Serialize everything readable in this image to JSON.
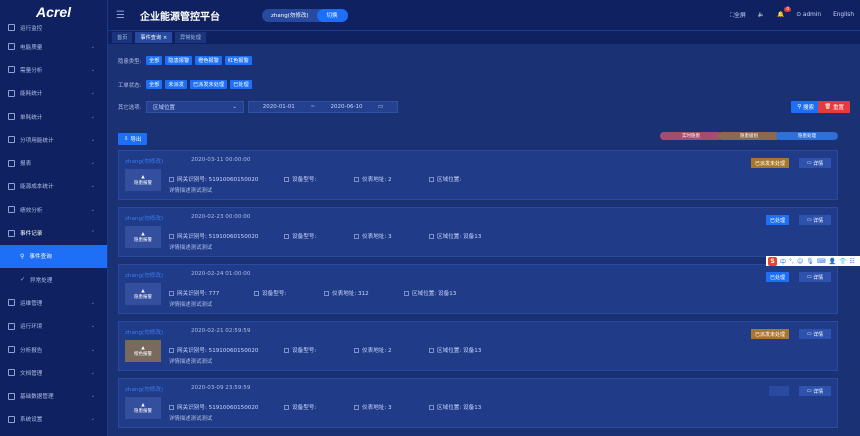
{
  "app": {
    "logo": "Acrel",
    "title": "企业能源管控平台",
    "user_chip": "zhang(勿修改)",
    "switch_label": "切换",
    "fullscreen": "全屏",
    "user": "admin",
    "lang": "English",
    "bell_count": "0"
  },
  "sidebar": {
    "top_partial": "运行监控",
    "items": [
      {
        "label": "电能质量"
      },
      {
        "label": "需量分析"
      },
      {
        "label": "能耗统计"
      },
      {
        "label": "单耗统计"
      },
      {
        "label": "分项用能统计"
      },
      {
        "label": "报表"
      },
      {
        "label": "能源成本统计"
      },
      {
        "label": "绩效分析"
      },
      {
        "label": "事件记录"
      }
    ],
    "sub_active": "事件查询",
    "sub_other": "异常处理",
    "items_after": [
      {
        "label": "运维管理"
      },
      {
        "label": "运行环境"
      },
      {
        "label": "分析报告"
      },
      {
        "label": "文档管理"
      },
      {
        "label": "基础数据管理"
      },
      {
        "label": "系统设置"
      },
      {
        "label": "日志管理"
      }
    ]
  },
  "tabs": {
    "home": "首页",
    "event": "事件查询",
    "abnormal": "异常处理"
  },
  "filters": {
    "type_label": "隐患类型:",
    "type_chips": [
      "全部",
      "隐患报警",
      "橙色报警",
      "红色报警"
    ],
    "status_label": "工单状态:",
    "status_chips": [
      "全部",
      "未派发",
      "已派发未处理",
      "已处理"
    ],
    "other_label": "其它选项:",
    "area_placeholder": "区域位置",
    "date_start": "2020-01-01",
    "date_sep": "~",
    "date_end": "2020-06-10",
    "search": "搜索",
    "reset": "重置"
  },
  "export_label": "导出",
  "legend": [
    "实时隐患",
    "隐患级别",
    "隐患处理"
  ],
  "legend_colors": [
    "#a34e6e",
    "#8c6a52",
    "#2e6fd8"
  ],
  "events": [
    {
      "who": "zhang(勿修改)",
      "time": "2020-03-11 00:00:00",
      "type": "隐患报警",
      "type_warn": false,
      "gateway": "网关识别号: 51910060150020",
      "device": "设备型号:",
      "address": "仪表地址: 2",
      "area": "区域位置:",
      "desc": "详情描述测试测试",
      "status": "已派发未处理",
      "status_kind": "pending",
      "detail": "详情"
    },
    {
      "who": "zhang(勿修改)",
      "time": "2020-02-23 00:00:00",
      "type": "隐患报警",
      "type_warn": false,
      "gateway": "网关识别号: 51910060150020",
      "device": "设备型号:",
      "address": "仪表地址: 3",
      "area": "区域位置: 设备13",
      "desc": "详情描述测试测试",
      "status": "已处理",
      "status_kind": "done",
      "detail": "详情"
    },
    {
      "who": "zhang(勿修改)",
      "time": "2020-02-24 01:00:00",
      "type": "隐患报警",
      "type_warn": false,
      "gateway": "网关识别号: 777",
      "device": "设备型号:",
      "address": "仪表地址: 312",
      "area": "区域位置: 设备13",
      "desc": "详情描述测试测试",
      "status": "已处理",
      "status_kind": "done",
      "detail": "详情"
    },
    {
      "who": "zhang(勿修改)",
      "time": "2020-02-21 02:59:59",
      "type": "橙色报警",
      "type_warn": true,
      "gateway": "网关识别号: 51910060150020",
      "device": "设备型号:",
      "address": "仪表地址: 2",
      "area": "区域位置: 设备13",
      "desc": "详情描述测试测试",
      "status": "已派发未处理",
      "status_kind": "pending",
      "detail": "详情"
    },
    {
      "who": "zhang(勿修改)",
      "time": "2020-03-09 23:59:59",
      "type": "隐患报警",
      "type_warn": false,
      "gateway": "网关识别号: 51910060150020",
      "device": "设备型号:",
      "address": "仪表地址: 3",
      "area": "区域位置: 设备13",
      "desc": "详情描述测试测试",
      "status": "",
      "status_kind": "none",
      "detail": "详情"
    }
  ],
  "ime": {
    "brand": "S",
    "text": "中"
  }
}
